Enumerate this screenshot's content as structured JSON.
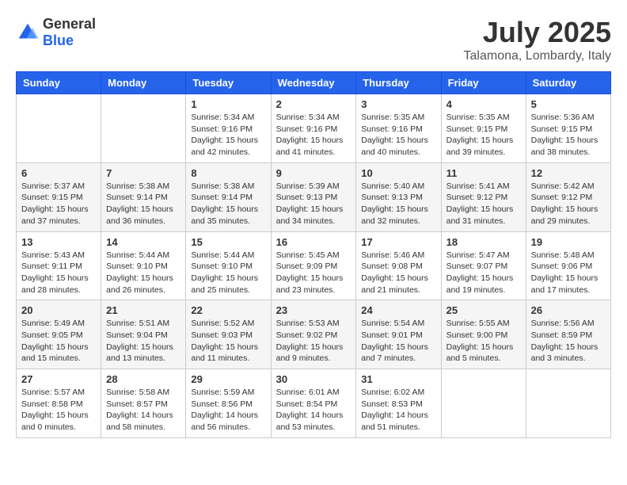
{
  "logo": {
    "general": "General",
    "blue": "Blue"
  },
  "header": {
    "month": "July 2025",
    "location": "Talamona, Lombardy, Italy"
  },
  "weekdays": [
    "Sunday",
    "Monday",
    "Tuesday",
    "Wednesday",
    "Thursday",
    "Friday",
    "Saturday"
  ],
  "weeks": [
    [
      {
        "day": "",
        "sunrise": "",
        "sunset": "",
        "daylight": ""
      },
      {
        "day": "",
        "sunrise": "",
        "sunset": "",
        "daylight": ""
      },
      {
        "day": "1",
        "sunrise": "Sunrise: 5:34 AM",
        "sunset": "Sunset: 9:16 PM",
        "daylight": "Daylight: 15 hours and 42 minutes."
      },
      {
        "day": "2",
        "sunrise": "Sunrise: 5:34 AM",
        "sunset": "Sunset: 9:16 PM",
        "daylight": "Daylight: 15 hours and 41 minutes."
      },
      {
        "day": "3",
        "sunrise": "Sunrise: 5:35 AM",
        "sunset": "Sunset: 9:16 PM",
        "daylight": "Daylight: 15 hours and 40 minutes."
      },
      {
        "day": "4",
        "sunrise": "Sunrise: 5:35 AM",
        "sunset": "Sunset: 9:15 PM",
        "daylight": "Daylight: 15 hours and 39 minutes."
      },
      {
        "day": "5",
        "sunrise": "Sunrise: 5:36 AM",
        "sunset": "Sunset: 9:15 PM",
        "daylight": "Daylight: 15 hours and 38 minutes."
      }
    ],
    [
      {
        "day": "6",
        "sunrise": "Sunrise: 5:37 AM",
        "sunset": "Sunset: 9:15 PM",
        "daylight": "Daylight: 15 hours and 37 minutes."
      },
      {
        "day": "7",
        "sunrise": "Sunrise: 5:38 AM",
        "sunset": "Sunset: 9:14 PM",
        "daylight": "Daylight: 15 hours and 36 minutes."
      },
      {
        "day": "8",
        "sunrise": "Sunrise: 5:38 AM",
        "sunset": "Sunset: 9:14 PM",
        "daylight": "Daylight: 15 hours and 35 minutes."
      },
      {
        "day": "9",
        "sunrise": "Sunrise: 5:39 AM",
        "sunset": "Sunset: 9:13 PM",
        "daylight": "Daylight: 15 hours and 34 minutes."
      },
      {
        "day": "10",
        "sunrise": "Sunrise: 5:40 AM",
        "sunset": "Sunset: 9:13 PM",
        "daylight": "Daylight: 15 hours and 32 minutes."
      },
      {
        "day": "11",
        "sunrise": "Sunrise: 5:41 AM",
        "sunset": "Sunset: 9:12 PM",
        "daylight": "Daylight: 15 hours and 31 minutes."
      },
      {
        "day": "12",
        "sunrise": "Sunrise: 5:42 AM",
        "sunset": "Sunset: 9:12 PM",
        "daylight": "Daylight: 15 hours and 29 minutes."
      }
    ],
    [
      {
        "day": "13",
        "sunrise": "Sunrise: 5:43 AM",
        "sunset": "Sunset: 9:11 PM",
        "daylight": "Daylight: 15 hours and 28 minutes."
      },
      {
        "day": "14",
        "sunrise": "Sunrise: 5:44 AM",
        "sunset": "Sunset: 9:10 PM",
        "daylight": "Daylight: 15 hours and 26 minutes."
      },
      {
        "day": "15",
        "sunrise": "Sunrise: 5:44 AM",
        "sunset": "Sunset: 9:10 PM",
        "daylight": "Daylight: 15 hours and 25 minutes."
      },
      {
        "day": "16",
        "sunrise": "Sunrise: 5:45 AM",
        "sunset": "Sunset: 9:09 PM",
        "daylight": "Daylight: 15 hours and 23 minutes."
      },
      {
        "day": "17",
        "sunrise": "Sunrise: 5:46 AM",
        "sunset": "Sunset: 9:08 PM",
        "daylight": "Daylight: 15 hours and 21 minutes."
      },
      {
        "day": "18",
        "sunrise": "Sunrise: 5:47 AM",
        "sunset": "Sunset: 9:07 PM",
        "daylight": "Daylight: 15 hours and 19 minutes."
      },
      {
        "day": "19",
        "sunrise": "Sunrise: 5:48 AM",
        "sunset": "Sunset: 9:06 PM",
        "daylight": "Daylight: 15 hours and 17 minutes."
      }
    ],
    [
      {
        "day": "20",
        "sunrise": "Sunrise: 5:49 AM",
        "sunset": "Sunset: 9:05 PM",
        "daylight": "Daylight: 15 hours and 15 minutes."
      },
      {
        "day": "21",
        "sunrise": "Sunrise: 5:51 AM",
        "sunset": "Sunset: 9:04 PM",
        "daylight": "Daylight: 15 hours and 13 minutes."
      },
      {
        "day": "22",
        "sunrise": "Sunrise: 5:52 AM",
        "sunset": "Sunset: 9:03 PM",
        "daylight": "Daylight: 15 hours and 11 minutes."
      },
      {
        "day": "23",
        "sunrise": "Sunrise: 5:53 AM",
        "sunset": "Sunset: 9:02 PM",
        "daylight": "Daylight: 15 hours and 9 minutes."
      },
      {
        "day": "24",
        "sunrise": "Sunrise: 5:54 AM",
        "sunset": "Sunset: 9:01 PM",
        "daylight": "Daylight: 15 hours and 7 minutes."
      },
      {
        "day": "25",
        "sunrise": "Sunrise: 5:55 AM",
        "sunset": "Sunset: 9:00 PM",
        "daylight": "Daylight: 15 hours and 5 minutes."
      },
      {
        "day": "26",
        "sunrise": "Sunrise: 5:56 AM",
        "sunset": "Sunset: 8:59 PM",
        "daylight": "Daylight: 15 hours and 3 minutes."
      }
    ],
    [
      {
        "day": "27",
        "sunrise": "Sunrise: 5:57 AM",
        "sunset": "Sunset: 8:58 PM",
        "daylight": "Daylight: 15 hours and 0 minutes."
      },
      {
        "day": "28",
        "sunrise": "Sunrise: 5:58 AM",
        "sunset": "Sunset: 8:57 PM",
        "daylight": "Daylight: 14 hours and 58 minutes."
      },
      {
        "day": "29",
        "sunrise": "Sunrise: 5:59 AM",
        "sunset": "Sunset: 8:56 PM",
        "daylight": "Daylight: 14 hours and 56 minutes."
      },
      {
        "day": "30",
        "sunrise": "Sunrise: 6:01 AM",
        "sunset": "Sunset: 8:54 PM",
        "daylight": "Daylight: 14 hours and 53 minutes."
      },
      {
        "day": "31",
        "sunrise": "Sunrise: 6:02 AM",
        "sunset": "Sunset: 8:53 PM",
        "daylight": "Daylight: 14 hours and 51 minutes."
      },
      {
        "day": "",
        "sunrise": "",
        "sunset": "",
        "daylight": ""
      },
      {
        "day": "",
        "sunrise": "",
        "sunset": "",
        "daylight": ""
      }
    ]
  ]
}
